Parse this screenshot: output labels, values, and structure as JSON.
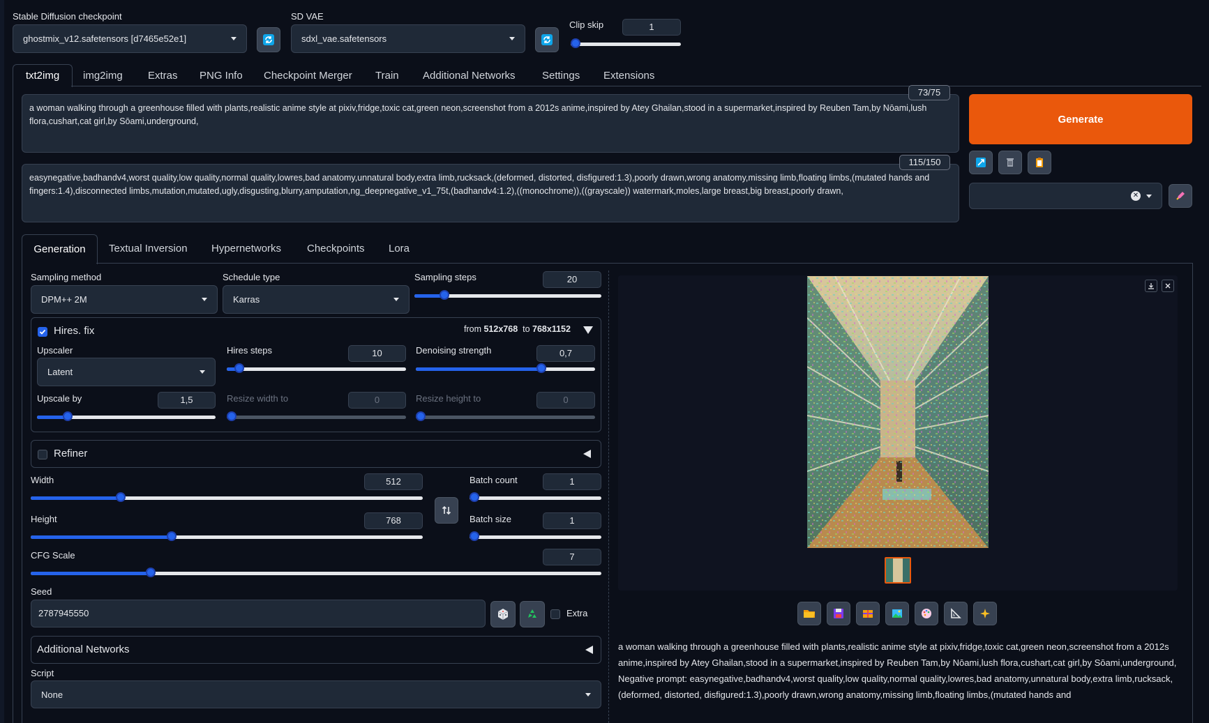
{
  "top": {
    "checkpoint_label": "Stable Diffusion checkpoint",
    "checkpoint_value": "ghostmix_v12.safetensors [d7465e52e1]",
    "vae_label": "SD VAE",
    "vae_value": "sdxl_vae.safetensors",
    "clip_skip_label": "Clip skip",
    "clip_skip_value": "1"
  },
  "main_tabs": [
    "txt2img",
    "img2img",
    "Extras",
    "PNG Info",
    "Checkpoint Merger",
    "Train",
    "Additional Networks",
    "Settings",
    "Extensions"
  ],
  "prompt": {
    "text": "a woman walking through a greenhouse filled with plants,realistic anime style at pixiv,fridge,toxic cat,green neon,screenshot from a 2012s anime,inspired by Atey Ghailan,stood in a supermarket,inspired by Reuben Tam,by Nōami,lush flora,cushart,cat girl,by Sōami,underground,",
    "counter": "73/75"
  },
  "negative_prompt": {
    "text": "easynegative,badhandv4,worst quality,low quality,normal quality,lowres,bad anatomy,unnatural body,extra limb,rucksack,(deformed, distorted, disfigured:1.3),poorly drawn,wrong anatomy,missing limb,floating limbs,(mutated hands and fingers:1.4),disconnected limbs,mutation,mutated,ugly,disgusting,blurry,amputation,ng_deepnegative_v1_75t,(badhandv4:1.2),((monochrome)),((grayscale)) watermark,moles,large breast,big breast,poorly drawn,",
    "counter": "115/150"
  },
  "generate_label": "Generate",
  "sub_tabs": [
    "Generation",
    "Textual Inversion",
    "Hypernetworks",
    "Checkpoints",
    "Lora"
  ],
  "sampling": {
    "method_label": "Sampling method",
    "method_value": "DPM++ 2M",
    "schedule_label": "Schedule type",
    "schedule_value": "Karras",
    "steps_label": "Sampling steps",
    "steps_value": "20",
    "steps_fraction": 0.16
  },
  "hires": {
    "label": "Hires. fix",
    "enabled": true,
    "summary_from": "from",
    "summary_from_size": "512x768",
    "summary_to": "to",
    "summary_to_size": "768x1152",
    "upscaler_label": "Upscaler",
    "upscaler_value": "Latent",
    "steps_label": "Hires steps",
    "steps_value": "10",
    "steps_fraction": 0.07,
    "denoise_label": "Denoising strength",
    "denoise_value": "0,7",
    "denoise_fraction": 0.7,
    "upscale_by_label": "Upscale by",
    "upscale_by_value": "1,5",
    "upscale_by_fraction": 0.17,
    "resize_w_label": "Resize width to",
    "resize_w_value": "0",
    "resize_h_label": "Resize height to",
    "resize_h_value": "0"
  },
  "refiner": {
    "label": "Refiner",
    "enabled": false
  },
  "size": {
    "width_label": "Width",
    "width_value": "512",
    "width_fraction": 0.23,
    "height_label": "Height",
    "height_value": "768",
    "height_fraction": 0.36,
    "batch_count_label": "Batch count",
    "batch_count_value": "1",
    "batch_size_label": "Batch size",
    "batch_size_value": "1"
  },
  "cfg": {
    "label": "CFG Scale",
    "value": "7",
    "fraction": 0.21
  },
  "seed": {
    "label": "Seed",
    "value": "2787945550",
    "extra_label": "Extra"
  },
  "additional_networks_label": "Additional Networks",
  "script": {
    "label": "Script",
    "value": "None"
  },
  "output": {
    "info_prompt": "a woman walking through a greenhouse filled with plants,realistic anime style at pixiv,fridge,toxic cat,green neon,screenshot from a 2012s anime,inspired by Atey Ghailan,stood in a supermarket,inspired by Reuben Tam,by Nōami,lush flora,cushart,cat girl,by Sōami,underground,",
    "info_negative": "Negative prompt: easynegative,badhandv4,worst quality,low quality,normal quality,lowres,bad anatomy,unnatural body,extra limb,rucksack,(deformed, distorted, disfigured:1.3),poorly drawn,wrong anatomy,missing limb,floating limbs,(mutated hands and"
  },
  "colors": {
    "accent": "#2563eb",
    "generate": "#ea580c",
    "background": "#0b0f19",
    "panel": "#1f2937"
  },
  "icons": [
    "refresh-icon",
    "folder-icon",
    "save-icon",
    "zip-icon",
    "image-icon",
    "palette-icon",
    "ruler-icon",
    "sparkle-icon",
    "dice-icon",
    "recycle-icon",
    "swap-icon",
    "trash-icon",
    "clipboard-icon",
    "pencil-icon",
    "download-icon",
    "close-icon"
  ]
}
